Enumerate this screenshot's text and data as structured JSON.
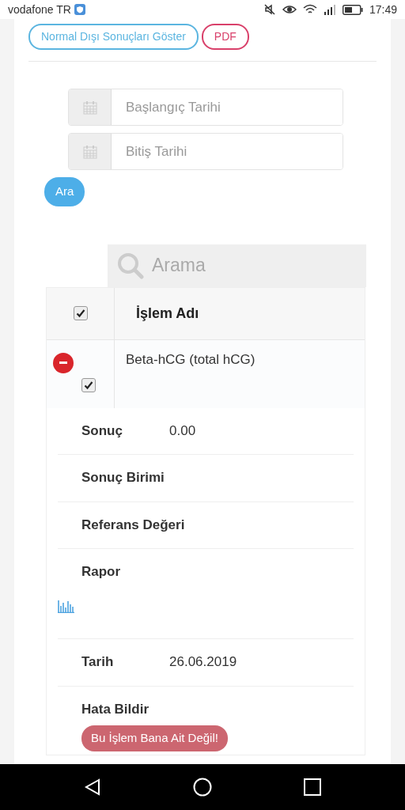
{
  "status_bar": {
    "carrier": "vodafone TR",
    "time": "17:49"
  },
  "actions": [
    {
      "label": "Normal Dışı Sonuçları Göster",
      "kind": "info"
    },
    {
      "label": "PDF",
      "kind": "danger"
    }
  ],
  "date_fields": [
    {
      "placeholder": "Başlangıç Tarihi"
    },
    {
      "placeholder": "Bitiş Tarihi"
    }
  ],
  "search_button": "Ara",
  "table_search": {
    "placeholder": "Arama"
  },
  "table": {
    "header": {
      "checked": true,
      "label": "İşlem Adı"
    },
    "rows": [
      {
        "expanded": true,
        "checked": true,
        "name": "Beta-hCG (total hCG)",
        "details": [
          {
            "label": "Sonuç",
            "value": "0.00"
          },
          {
            "label": "Sonuç Birimi"
          },
          {
            "label": "Referans Değeri"
          },
          {
            "label": "Rapor",
            "kind": "chart-link"
          },
          {
            "label": "Tarih",
            "value": "26.06.2019"
          },
          {
            "label": "Hata Bildir",
            "button": "Bu İşlem Bana Ait Değil!"
          }
        ]
      }
    ]
  }
}
